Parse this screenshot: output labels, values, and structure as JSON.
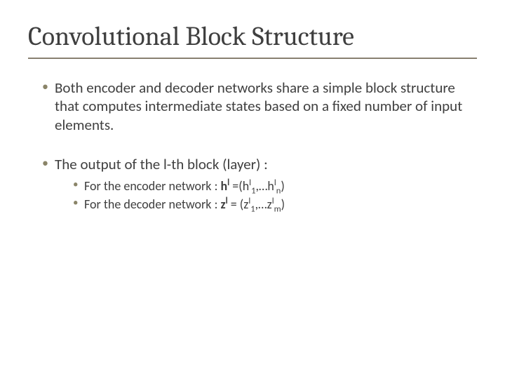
{
  "title": "Convolutional Block Structure",
  "bullets": {
    "b1": "Both encoder and decoder networks share a simple block structure that computes intermediate states based on a fixed number of input elements.",
    "b2": "The output of the l-th block (layer) :",
    "b2a_prefix": "For the encoder network : ",
    "b2a_sym": "h",
    "b2a_eq_open": " =(h",
    "b2a_mid": ",…h",
    "b2a_close": ")",
    "b2a_sub1": "1",
    "b2a_subn": "n",
    "b2b_prefix": "For the decoder network : ",
    "b2b_sym": "z",
    "b2b_eq_open": " = (z",
    "b2b_mid": ",…z",
    "b2b_close": ")",
    "b2b_sub1": "1",
    "b2b_subm": "m",
    "sup_l": "l"
  }
}
